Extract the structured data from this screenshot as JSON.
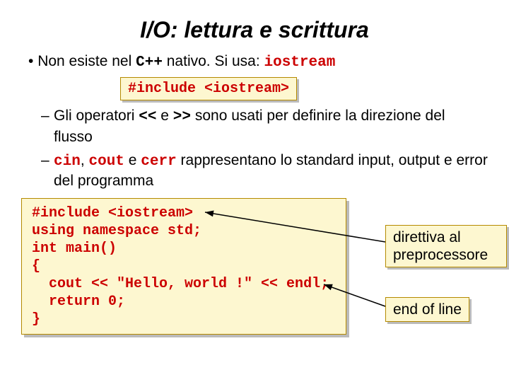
{
  "title": "I/O: lettura e scrittura",
  "bullet1": {
    "pre": "Non esiste nel ",
    "cpp": "C++",
    "mid": " nativo. Si usa: ",
    "iostream": "iostream"
  },
  "include_box": "#include <iostream>",
  "sub1": {
    "pre": "Gli operatori ",
    "op1": "<<",
    "mid": " e ",
    "op2": ">>",
    "post": " sono usati per definire la direzione del flusso"
  },
  "sub2": {
    "cin": "cin",
    "sep1": ", ",
    "cout": "cout",
    "sep2": " e ",
    "cerr": "cerr",
    "post": " rappresentano lo standard input, output e error del programma"
  },
  "code": {
    "l1": "#include <iostream>",
    "l2": "using namespace std;",
    "l3": "int main()",
    "l4": "{",
    "l5": "  cout << \"Hello, world !\" << endl;",
    "l6": "  return 0;",
    "l7": "}"
  },
  "annot1": "direttiva al preprocessore",
  "annot2": "end of line"
}
